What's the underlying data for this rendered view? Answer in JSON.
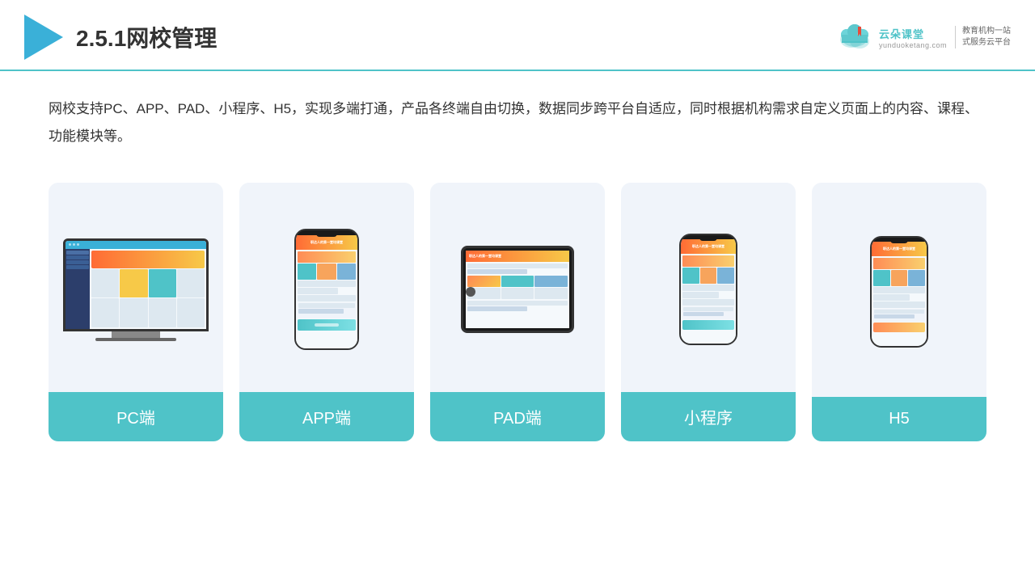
{
  "header": {
    "title": "2.5.1网校管理",
    "brand_name": "云朵课堂",
    "brand_domain": "yunduoketang.com",
    "brand_slogan_line1": "教育机构一站",
    "brand_slogan_line2": "式服务云平台"
  },
  "description": {
    "text": "网校支持PC、APP、PAD、小程序、H5，实现多端打通，产品各终端自由切换，数据同步跨平台自适应，同时根据机构需求自定义页面上的内容、课程、功能模块等。"
  },
  "cards": [
    {
      "id": "pc",
      "label": "PC端"
    },
    {
      "id": "app",
      "label": "APP端"
    },
    {
      "id": "pad",
      "label": "PAD端"
    },
    {
      "id": "miniapp",
      "label": "小程序"
    },
    {
      "id": "h5",
      "label": "H5"
    }
  ]
}
